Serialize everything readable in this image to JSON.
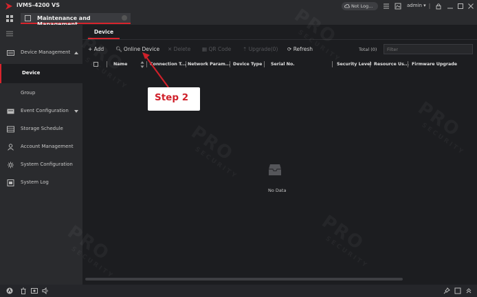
{
  "app": {
    "name": "iVMS-4200 VS",
    "tab_label": "Maintenance and Management",
    "cloud_status": "Not Log...",
    "user": "admin"
  },
  "sidebar": {
    "items": [
      {
        "label": "Device Management",
        "icon": "device-icon",
        "expanded": true
      },
      {
        "label": "Device",
        "active": true
      },
      {
        "label": "Group"
      },
      {
        "label": "Event Configuration",
        "icon": "event-icon",
        "expanded": false
      },
      {
        "label": "Storage Schedule",
        "icon": "storage-icon"
      },
      {
        "label": "Account Management",
        "icon": "account-icon"
      },
      {
        "label": "System Configuration",
        "icon": "gear-icon"
      },
      {
        "label": "System Log",
        "icon": "log-icon"
      }
    ]
  },
  "main": {
    "subtab": "Device",
    "toolbar": {
      "add": "Add",
      "online_device": "Online Device",
      "delete": "Delete",
      "qr_code": "QR Code",
      "upgrade": "Upgrade(0)",
      "refresh": "Refresh",
      "total": "Total (0)",
      "filter_placeholder": "Filter"
    },
    "columns": [
      "Name",
      "Connection T...",
      "Network Param...",
      "Device Type",
      "Serial No.",
      "Security Level",
      "Resource Us...",
      "Firmware Upgrade"
    ],
    "empty_text": "No Data"
  },
  "annotation": {
    "label": "Step 2",
    "color": "#d0202a"
  },
  "watermark": {
    "text": "PRO",
    "subtext": "SECURITY"
  },
  "colors": {
    "accent": "#d8242c",
    "background": "#1c1d20",
    "panel": "#2a2b2e"
  }
}
